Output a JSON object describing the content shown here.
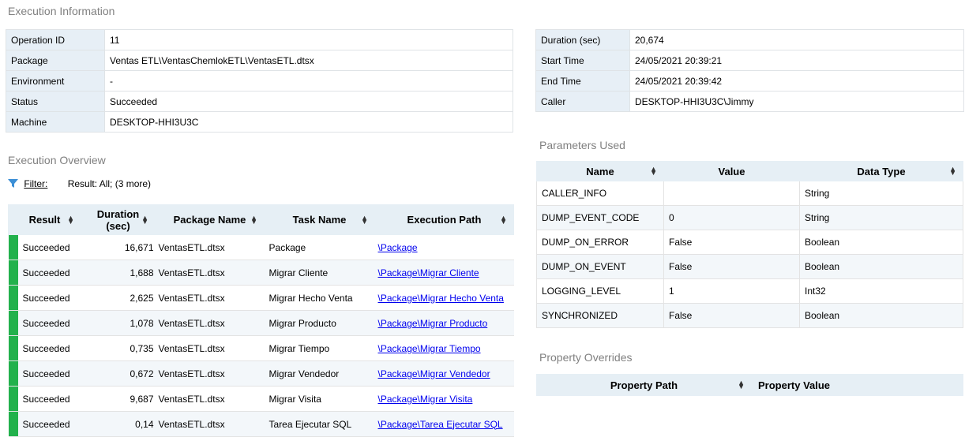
{
  "execution_info": {
    "title": "Execution Information",
    "left": [
      {
        "label": "Operation ID",
        "value": "11"
      },
      {
        "label": "Package",
        "value": "Ventas ETL\\VentasChemlokETL\\VentasETL.dtsx"
      },
      {
        "label": "Environment",
        "value": "-"
      },
      {
        "label": "Status",
        "value": "Succeeded"
      },
      {
        "label": "Machine",
        "value": "DESKTOP-HHI3U3C"
      }
    ],
    "right": [
      {
        "label": "Duration (sec)",
        "value": "20,674"
      },
      {
        "label": "Start Time",
        "value": "24/05/2021 20:39:21"
      },
      {
        "label": "End Time",
        "value": "24/05/2021 20:39:42"
      },
      {
        "label": "Caller",
        "value": "DESKTOP-HHI3U3C\\Jimmy"
      }
    ]
  },
  "overview": {
    "title": "Execution Overview",
    "filter_label": "Filter:",
    "filter_text": "Result: All;  (3 more)",
    "columns": [
      "Result",
      "Duration\n(sec)",
      "Package Name",
      "Task Name",
      "Execution Path"
    ],
    "status_color": "#22b14c",
    "rows": [
      {
        "result": "Succeeded",
        "duration": "16,671",
        "package": "VentasETL.dtsx",
        "task": "Package",
        "path": "\\Package"
      },
      {
        "result": "Succeeded",
        "duration": "1,688",
        "package": "VentasETL.dtsx",
        "task": "Migrar Cliente",
        "path": "\\Package\\Migrar Cliente"
      },
      {
        "result": "Succeeded",
        "duration": "2,625",
        "package": "VentasETL.dtsx",
        "task": "Migrar Hecho Venta",
        "path": "\\Package\\Migrar Hecho Venta"
      },
      {
        "result": "Succeeded",
        "duration": "1,078",
        "package": "VentasETL.dtsx",
        "task": "Migrar Producto",
        "path": "\\Package\\Migrar Producto"
      },
      {
        "result": "Succeeded",
        "duration": "0,735",
        "package": "VentasETL.dtsx",
        "task": "Migrar Tiempo",
        "path": "\\Package\\Migrar Tiempo"
      },
      {
        "result": "Succeeded",
        "duration": "0,672",
        "package": "VentasETL.dtsx",
        "task": "Migrar Vendedor",
        "path": "\\Package\\Migrar Vendedor"
      },
      {
        "result": "Succeeded",
        "duration": "9,687",
        "package": "VentasETL.dtsx",
        "task": "Migrar Visita",
        "path": "\\Package\\Migrar Visita"
      },
      {
        "result": "Succeeded",
        "duration": "0,14",
        "package": "VentasETL.dtsx",
        "task": "Tarea Ejecutar SQL",
        "path": "\\Package\\Tarea Ejecutar SQL"
      }
    ]
  },
  "parameters": {
    "title": "Parameters Used",
    "columns": [
      "Name",
      "Value",
      "Data Type"
    ],
    "rows": [
      {
        "name": "CALLER_INFO",
        "value": "",
        "type": "String"
      },
      {
        "name": "DUMP_EVENT_CODE",
        "value": "0",
        "type": "String"
      },
      {
        "name": "DUMP_ON_ERROR",
        "value": "False",
        "type": "Boolean"
      },
      {
        "name": "DUMP_ON_EVENT",
        "value": "False",
        "type": "Boolean"
      },
      {
        "name": "LOGGING_LEVEL",
        "value": "1",
        "type": "Int32"
      },
      {
        "name": "SYNCHRONIZED",
        "value": "False",
        "type": "Boolean"
      }
    ]
  },
  "overrides": {
    "title": "Property Overrides",
    "columns": [
      "Property Path",
      "Property Value"
    ]
  }
}
